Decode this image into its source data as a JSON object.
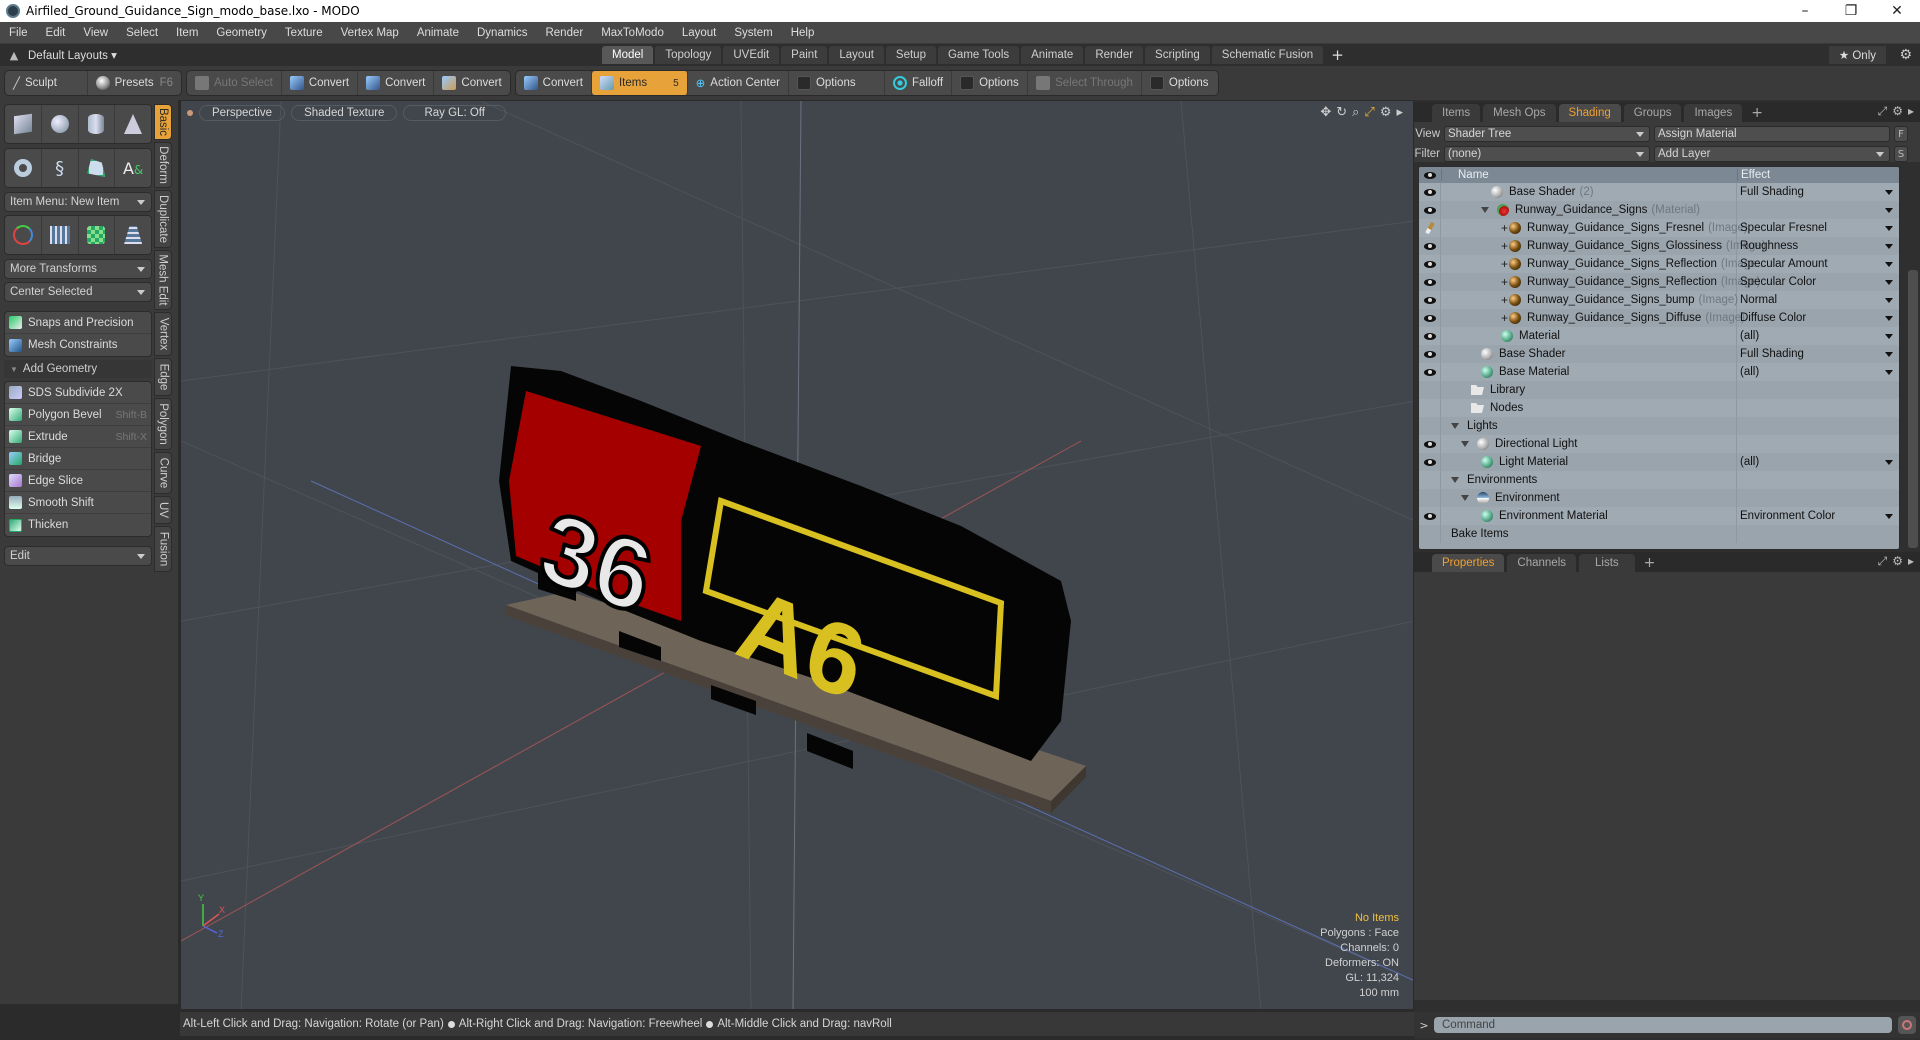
{
  "window": {
    "title": "Airfiled_Ground_Guidance_Sign_modo_base.lxo - MODO",
    "controls": {
      "minimize": "–",
      "restore": "❐",
      "close": "✕"
    }
  },
  "menu": [
    "File",
    "Edit",
    "View",
    "Select",
    "Item",
    "Geometry",
    "Texture",
    "Vertex Map",
    "Animate",
    "Dynamics",
    "Render",
    "MaxToModo",
    "Layout",
    "System",
    "Help"
  ],
  "layout_bar": {
    "layouts_label": "Default Layouts ▾",
    "tabs": [
      "Model",
      "Topology",
      "UVEdit",
      "Paint",
      "Layout",
      "Setup",
      "Game Tools",
      "Animate",
      "Render",
      "Scripting",
      "Schematic Fusion"
    ],
    "active_tab": "Model",
    "add_tab": "+",
    "only_label": "★ Only"
  },
  "toolbar": {
    "sculpt": "Sculpt",
    "presets": "Presets",
    "presets_key": "F6",
    "auto_select": "Auto Select",
    "convert1": "Convert",
    "convert2": "Convert",
    "convert3": "Convert",
    "convert4": "Convert",
    "items": "Items",
    "items_key": "5",
    "action_center": "Action Center",
    "options1": "Options",
    "falloff": "Falloff",
    "options2": "Options",
    "select_through": "Select Through",
    "options3": "Options"
  },
  "left_panel": {
    "item_menu": "Item Menu: New Item",
    "more_transforms": "More Transforms",
    "center_selected": "Center Selected",
    "snaps": "Snaps and Precision",
    "mesh_constraints": "Mesh Constraints",
    "add_geometry": "Add Geometry",
    "tools": [
      {
        "label": "SDS Subdivide 2X",
        "shortcut": ""
      },
      {
        "label": "Polygon Bevel",
        "shortcut": "Shift-B"
      },
      {
        "label": "Extrude",
        "shortcut": "Shift-X"
      },
      {
        "label": "Bridge",
        "shortcut": ""
      },
      {
        "label": "Edge Slice",
        "shortcut": ""
      },
      {
        "label": "Smooth Shift",
        "shortcut": ""
      },
      {
        "label": "Thicken",
        "shortcut": ""
      }
    ],
    "edit_dropdown": "Edit",
    "vertical_tabs": [
      "Basic",
      "Deform",
      "Duplicate",
      "Mesh Edit",
      "Vertex",
      "Edge",
      "Polygon",
      "Curve",
      "UV",
      "Fusion"
    ],
    "active_vertical_tab": "Basic"
  },
  "viewport": {
    "view_mode": "Perspective",
    "shading": "Shaded Texture",
    "raygl": "Ray GL: Off",
    "info": {
      "selection": "No Items",
      "polygons": "Polygons : Face",
      "channels": "Channels: 0",
      "deformers": "Deformers: ON",
      "gl": "GL: 11,324",
      "unit": "100 mm"
    },
    "sign": {
      "left_text": "36",
      "right_text": "A6"
    },
    "axis_labels": {
      "x": "X",
      "y": "Y",
      "z": "Z"
    }
  },
  "status_bar": {
    "hints": [
      "Alt-Left Click and Drag: Navigation: Rotate (or Pan)",
      "Alt-Right Click and Drag: Navigation: Freewheel",
      "Alt-Middle Click and Drag: navRoll"
    ]
  },
  "right_panel": {
    "tabs": [
      "Items",
      "Mesh Ops",
      "Shading",
      "Groups",
      "Images"
    ],
    "active_tab": "Shading",
    "view_label": "View",
    "view_value": "Shader Tree",
    "assign_material": "Assign Material",
    "f_btn": "F",
    "filter_label": "Filter",
    "filter_value": "(none)",
    "add_layer": "Add Layer",
    "s_btn": "S",
    "columns": {
      "name": "Name",
      "effect": "Effect"
    },
    "rows": [
      {
        "vis": "eye",
        "indent": 4,
        "icon": "white",
        "name": "Base Shader",
        "suffix": "(2)",
        "effect": "Full Shading",
        "dropdown": true
      },
      {
        "vis": "eye",
        "indent": 3,
        "icon": "red",
        "tri": true,
        "name": "Runway_Guidance_Signs",
        "suffix": "(Material)",
        "effect": "",
        "dropdown": true
      },
      {
        "vis": "brush",
        "indent": 5,
        "icon": "gold",
        "plus": true,
        "name": "Runway_Guidance_Signs_Fresnel",
        "suffix": "(Image)",
        "effect": "Specular Fresnel",
        "dropdown": true
      },
      {
        "vis": "eye",
        "indent": 5,
        "icon": "gold",
        "plus": true,
        "name": "Runway_Guidance_Signs_Glossiness",
        "suffix": "(Image)",
        "effect": "Roughness",
        "dropdown": true
      },
      {
        "vis": "eye",
        "indent": 5,
        "icon": "gold",
        "plus": true,
        "name": "Runway_Guidance_Signs_Reflection",
        "suffix": "(Image...",
        "effect": "Specular Amount",
        "dropdown": true
      },
      {
        "vis": "eye",
        "indent": 5,
        "icon": "gold",
        "plus": true,
        "name": "Runway_Guidance_Signs_Reflection",
        "suffix": "(Image)",
        "effect": "Specular Color",
        "dropdown": true
      },
      {
        "vis": "eye",
        "indent": 5,
        "icon": "gold",
        "plus": true,
        "name": "Runway_Guidance_Signs_bump",
        "suffix": "(Image)",
        "effect": "Normal",
        "dropdown": true
      },
      {
        "vis": "eye",
        "indent": 5,
        "icon": "gold",
        "plus": true,
        "name": "Runway_Guidance_Signs_Diffuse",
        "suffix": "(Image)",
        "effect": "Diffuse Color",
        "dropdown": true
      },
      {
        "vis": "eye",
        "indent": 5,
        "icon": "green",
        "name": "Material",
        "suffix": "",
        "effect": "(all)",
        "dropdown": true
      },
      {
        "vis": "eye",
        "indent": 3,
        "icon": "white",
        "name": "Base Shader",
        "suffix": "",
        "effect": "Full Shading",
        "dropdown": true
      },
      {
        "vis": "eye",
        "indent": 3,
        "icon": "green",
        "name": "Base Material",
        "suffix": "",
        "effect": "(all)",
        "dropdown": true
      },
      {
        "vis": "",
        "indent": 2,
        "icon": "folder",
        "name": "Library",
        "suffix": "",
        "effect": "",
        "dropdown": false
      },
      {
        "vis": "",
        "indent": 2,
        "icon": "folder",
        "name": "Nodes",
        "suffix": "",
        "effect": "",
        "dropdown": false
      },
      {
        "vis": "",
        "indent": 0,
        "icon": "",
        "tri": true,
        "name": "Lights",
        "suffix": "",
        "effect": "",
        "dropdown": false
      },
      {
        "vis": "eye",
        "indent": 1,
        "icon": "light",
        "tri": true,
        "name": "Directional Light",
        "suffix": "",
        "effect": "",
        "dropdown": false
      },
      {
        "vis": "eye",
        "indent": 3,
        "icon": "green",
        "name": "Light Material",
        "suffix": "",
        "effect": "(all)",
        "dropdown": true
      },
      {
        "vis": "",
        "indent": 0,
        "icon": "",
        "tri": true,
        "name": "Environments",
        "suffix": "",
        "effect": "",
        "dropdown": false
      },
      {
        "vis": "",
        "indent": 1,
        "icon": "env",
        "tri": true,
        "name": "Environment",
        "suffix": "",
        "effect": "",
        "dropdown": false
      },
      {
        "vis": "eye",
        "indent": 3,
        "icon": "green",
        "name": "Environment Material",
        "suffix": "",
        "effect": "Environment Color",
        "dropdown": true
      },
      {
        "vis": "",
        "indent": 0,
        "icon": "",
        "name": "Bake Items",
        "suffix": "",
        "effect": "",
        "dropdown": false
      }
    ],
    "lower_tabs": [
      "Properties",
      "Channels",
      "Lists"
    ],
    "lower_active_tab": "Properties",
    "command_prompt": ">",
    "command_placeholder": "Command"
  },
  "colors": {
    "accent": "#e8a23a",
    "tree_bg": "#9aa4ad",
    "viewport_bg": "#41464d",
    "sign_red": "#a40000",
    "sign_yellow": "#d8c020"
  }
}
